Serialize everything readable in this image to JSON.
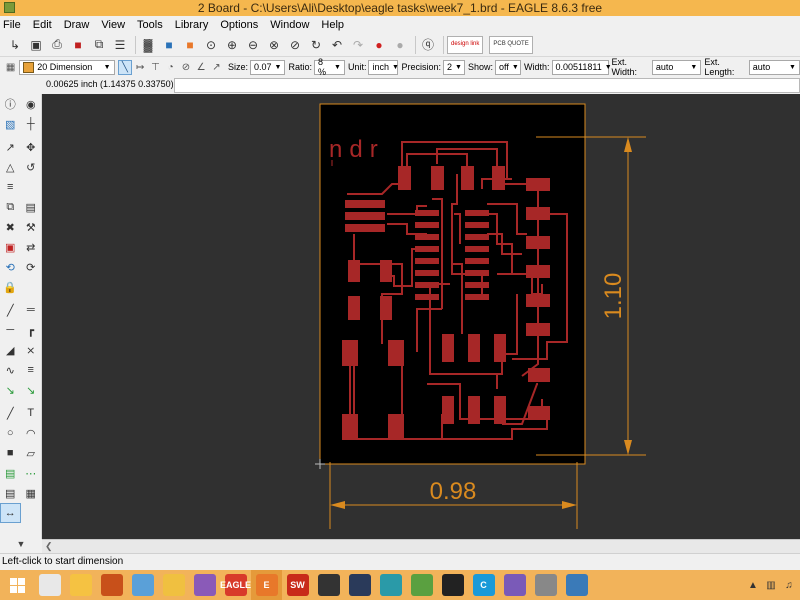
{
  "window": {
    "title": "2 Board - C:\\Users\\Ali\\Desktop\\eagle tasks\\week7_1.brd - EAGLE 8.6.3 free"
  },
  "menu": {
    "items": [
      "File",
      "Edit",
      "Draw",
      "View",
      "Tools",
      "Library",
      "Options",
      "Window",
      "Help"
    ]
  },
  "toolbar": {
    "design_link_logo": "design link",
    "pcb_quote_logo": "PCB QUOTE"
  },
  "params": {
    "layer": "20 Dimension",
    "size_label": "Size:",
    "size_value": "0.07",
    "ratio_label": "Ratio:",
    "ratio_value": "8 %",
    "unit_label": "Unit:",
    "unit_value": "inch",
    "precision_label": "Precision:",
    "precision_value": "2",
    "show_label": "Show:",
    "show_value": "off",
    "width_label": "Width:",
    "width_value": "0.00511811",
    "ext_width_label": "Ext. Width:",
    "ext_width_value": "auto",
    "ext_length_label": "Ext. Length:",
    "ext_length_value": "auto"
  },
  "command": {
    "coordinates": "0.00625 inch (1.14375 0.33750)",
    "input_value": ""
  },
  "board": {
    "silkscreen_text": "ndr",
    "dimension_vertical": "1.10",
    "dimension_horizontal": "0.98"
  },
  "status": {
    "text": "Left-click to start dimension"
  },
  "colors": {
    "canvas_bg": "#303030",
    "board_bg": "#000000",
    "copper": "#a72727",
    "dimension": "#d98a1f",
    "taskbar": "#f2b35a"
  },
  "taskbar": {
    "apps": [
      {
        "name": "chrome",
        "label": "",
        "color": "#e8e8e8",
        "active": false
      },
      {
        "name": "file-explorer",
        "label": "",
        "color": "#f5c242",
        "active": false
      },
      {
        "name": "settings",
        "label": "",
        "color": "#c8501a",
        "active": false
      },
      {
        "name": "app-blue",
        "label": "",
        "color": "#5aa0d8",
        "active": false
      },
      {
        "name": "folder",
        "label": "",
        "color": "#f0c040",
        "active": false
      },
      {
        "name": "app-colorful",
        "label": "",
        "color": "#8a5ab8",
        "active": false
      },
      {
        "name": "eagle",
        "label": "EAGLE",
        "color": "#d83a2a",
        "active": false
      },
      {
        "name": "eagle-active",
        "label": "E",
        "color": "#e8782a",
        "active": true
      },
      {
        "name": "solidworks",
        "label": "SW",
        "color": "#c82a1a",
        "active": false
      },
      {
        "name": "inkscape",
        "label": "",
        "color": "#333333",
        "active": false
      },
      {
        "name": "app-photoshop",
        "label": "",
        "color": "#2a3a5a",
        "active": false
      },
      {
        "name": "arduino",
        "label": "",
        "color": "#2a9aa8",
        "active": false
      },
      {
        "name": "app-notepad",
        "label": "",
        "color": "#5aa040",
        "active": false
      },
      {
        "name": "app-cat",
        "label": "",
        "color": "#222222",
        "active": false
      },
      {
        "name": "app-c",
        "label": "C",
        "color": "#1a9ad8",
        "active": false
      },
      {
        "name": "app-graph",
        "label": "",
        "color": "#7a5ab8",
        "active": false
      },
      {
        "name": "app-eye",
        "label": "",
        "color": "#888888",
        "active": false
      },
      {
        "name": "app-screen",
        "label": "",
        "color": "#3a7ab8",
        "active": false
      }
    ]
  }
}
